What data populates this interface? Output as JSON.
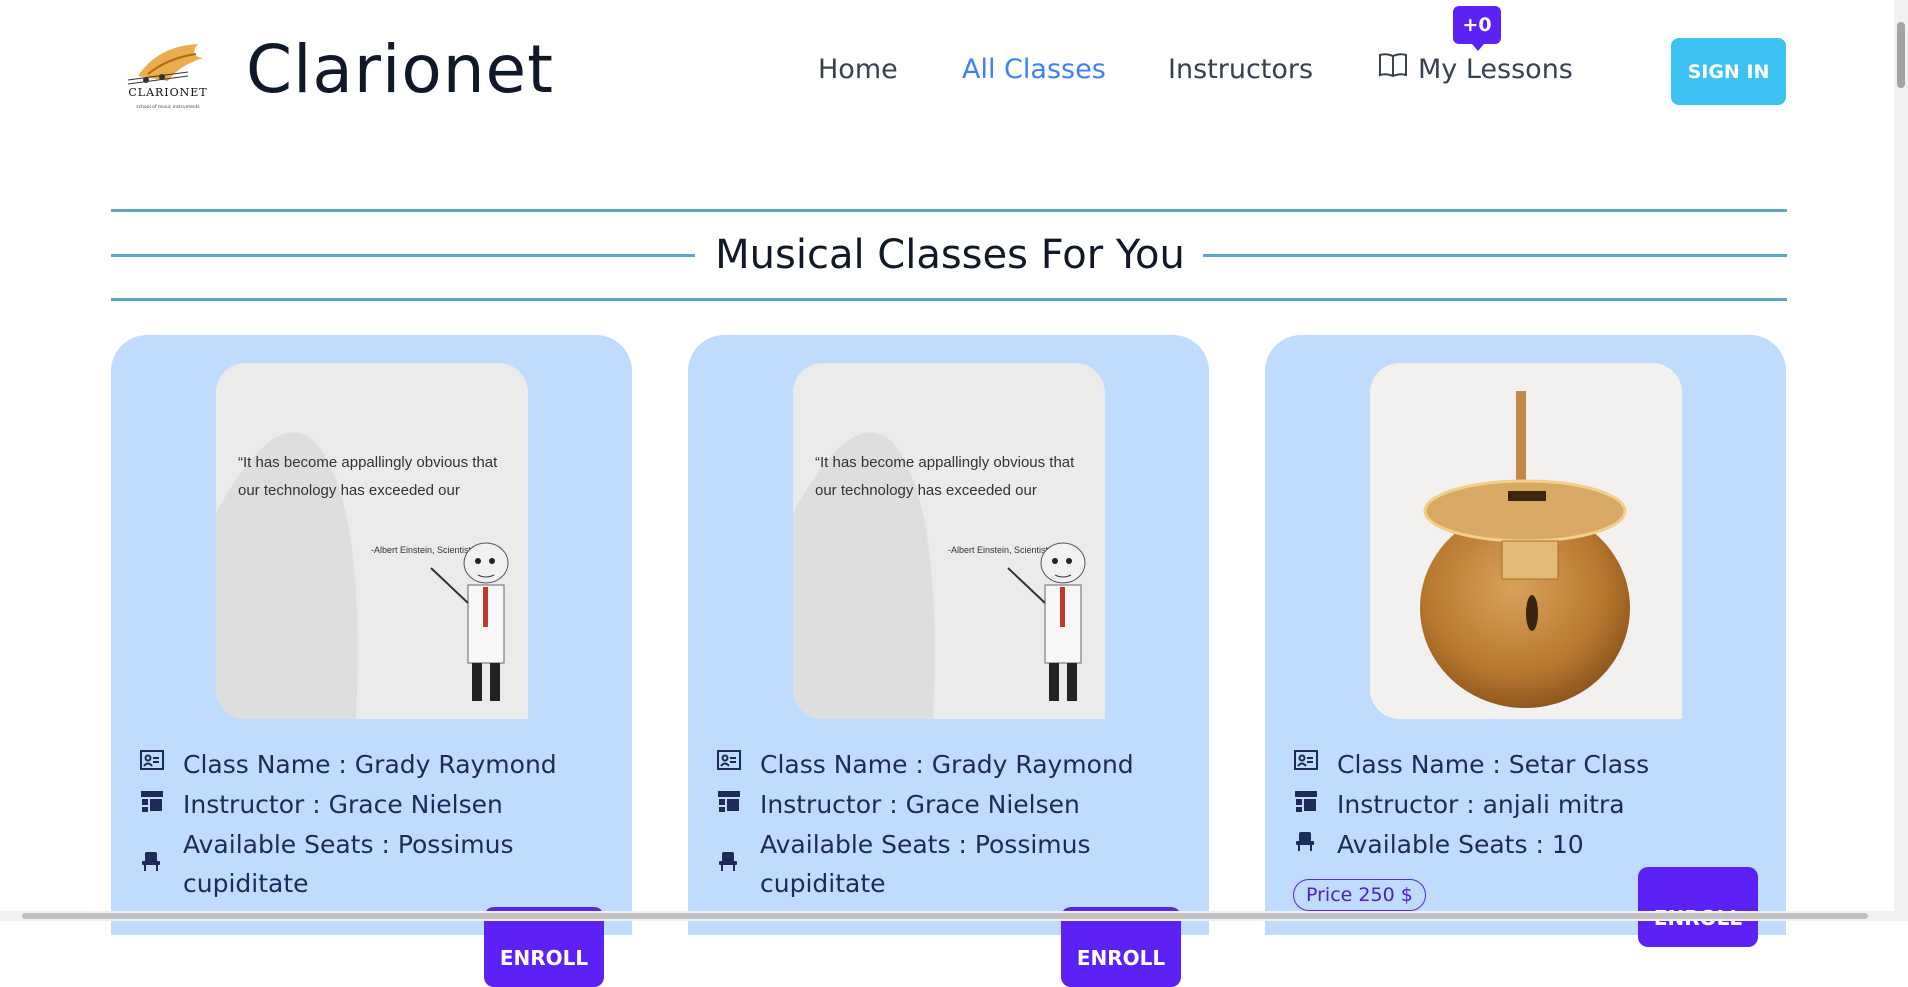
{
  "header": {
    "brand": "Clarionet",
    "logo_text": "CLARIONET",
    "logo_subtext": "school of music instruments",
    "nav": [
      {
        "label": "Home"
      },
      {
        "label": "All Classes"
      },
      {
        "label": "Instructors"
      },
      {
        "label": "My Lessons"
      }
    ],
    "lessons_badge": "+0",
    "sign_in": "SIGN IN"
  },
  "section": {
    "title": "Musical Classes For You"
  },
  "quote_image": {
    "quote": "“It has become appallingly obvious that our technology has exceeded our humanity.”",
    "author": "-Albert Einstein, Scientist"
  },
  "classes": [
    {
      "class_name": "Class Name : Grady Raymond",
      "instructor": "Instructor : Grace Nielsen",
      "seats": "Available Seats : Possimus cupiditate",
      "enroll": "ENROLL"
    },
    {
      "class_name": "Class Name : Grady Raymond",
      "instructor": "Instructor : Grace Nielsen",
      "seats": "Available Seats : Possimus cupiditate",
      "enroll": "ENROLL"
    },
    {
      "class_name": "Class Name : Setar Class",
      "instructor": "Instructor : anjali mitra",
      "seats": "Available Seats : 10",
      "price": "Price 250 $",
      "enroll": "ENROLL"
    }
  ],
  "colors": {
    "accent": "#5b21f5",
    "card_bg": "#bfdbfe",
    "signin_bg": "#3ec1f3",
    "nav_active": "#3b82f6",
    "divider": "#5ba8c4"
  }
}
